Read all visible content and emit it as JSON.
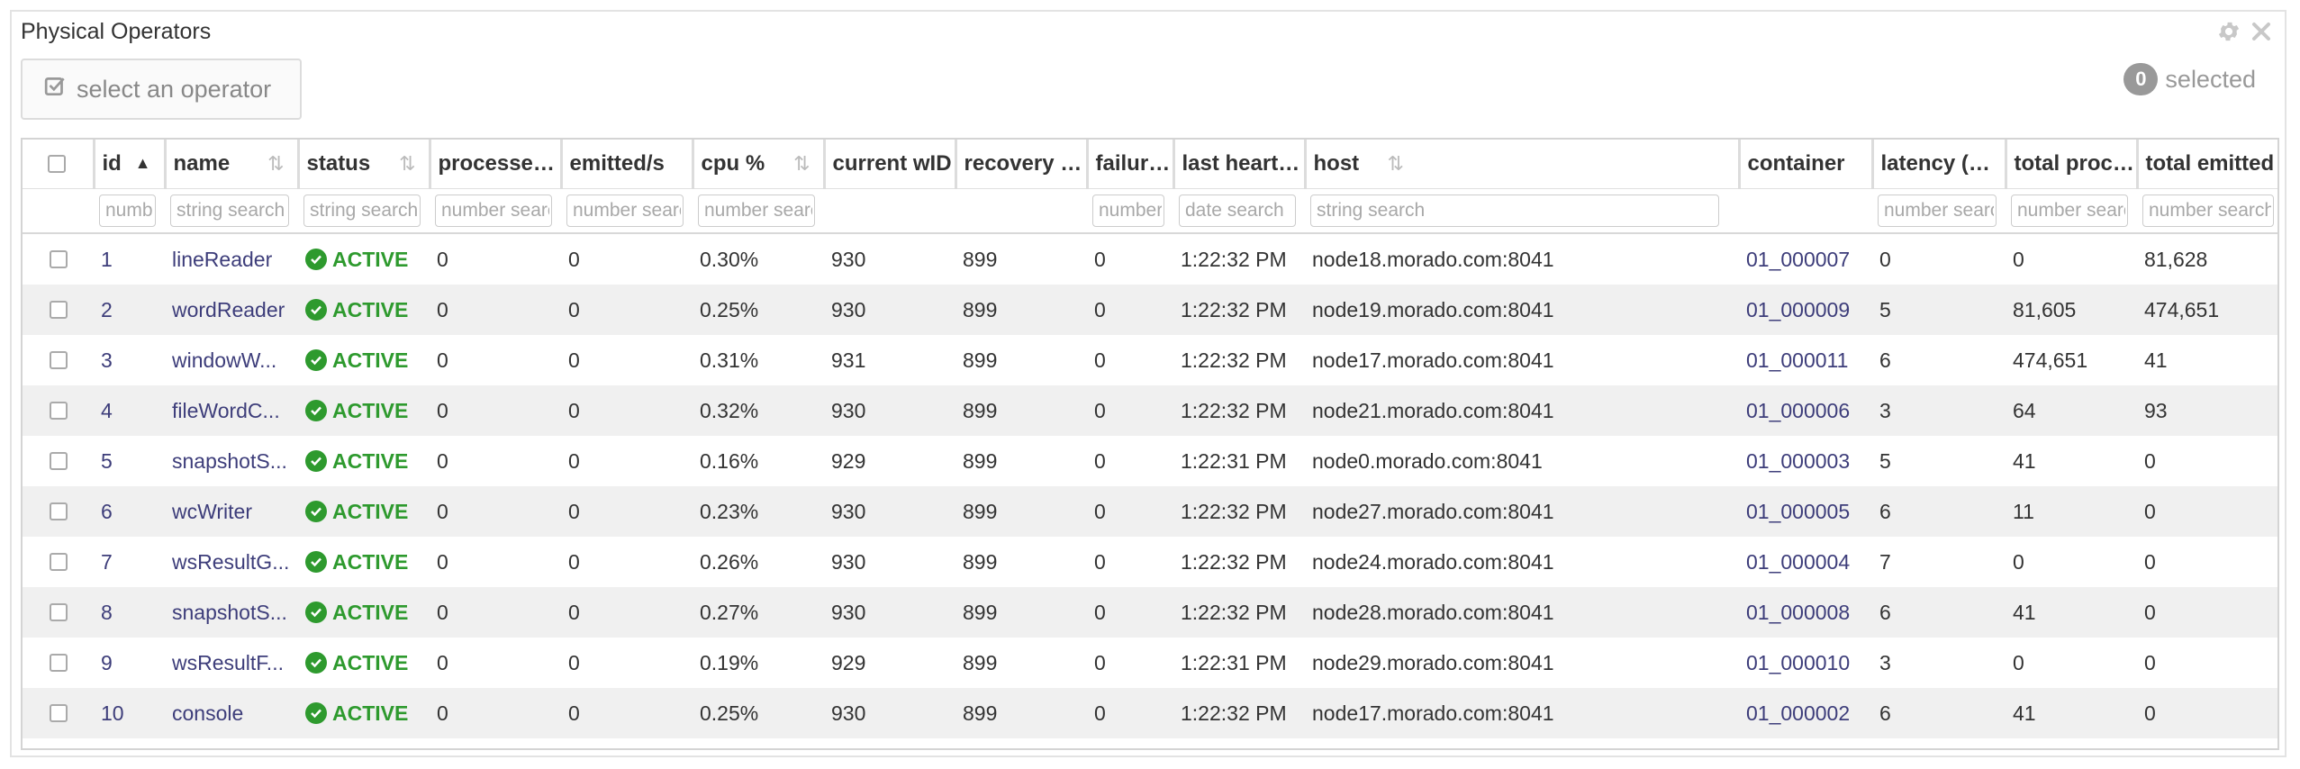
{
  "panel": {
    "title": "Physical Operators",
    "select_label": "select an operator",
    "selected_count": "0",
    "selected_label": "selected"
  },
  "columns": [
    {
      "label": "id",
      "filter": "number"
    },
    {
      "label": "name",
      "filter": "string search"
    },
    {
      "label": "status",
      "filter": "string search"
    },
    {
      "label": "processed/s",
      "filter": "number search"
    },
    {
      "label": "emitted/s",
      "filter": "number search"
    },
    {
      "label": "cpu %",
      "filter": "number search"
    },
    {
      "label": "current wID",
      "filter": ""
    },
    {
      "label": "recovery wID",
      "filter": ""
    },
    {
      "label": "failures",
      "filter": "number"
    },
    {
      "label": "last heartbeat",
      "filter": "date search"
    },
    {
      "label": "host",
      "filter": "string search"
    },
    {
      "label": "container",
      "filter": ""
    },
    {
      "label": "latency (ms)",
      "filter": "number search"
    },
    {
      "label": "total processed",
      "filter": "number search"
    },
    {
      "label": "total emitted",
      "filter": "number search"
    }
  ],
  "rows": [
    {
      "id": "1",
      "name": "lineReader",
      "status": "ACTIVE",
      "processed": "0",
      "emitted": "0",
      "cpu": "0.30%",
      "current": "930",
      "recovery": "899",
      "failures": "0",
      "heartbeat": "1:22:32 PM",
      "host": "node18.morado.com:8041",
      "container": "01_000007",
      "latency": "0",
      "total_processed": "0",
      "total_emitted": "81,628"
    },
    {
      "id": "2",
      "name": "wordReader",
      "status": "ACTIVE",
      "processed": "0",
      "emitted": "0",
      "cpu": "0.25%",
      "current": "930",
      "recovery": "899",
      "failures": "0",
      "heartbeat": "1:22:32 PM",
      "host": "node19.morado.com:8041",
      "container": "01_000009",
      "latency": "5",
      "total_processed": "81,605",
      "total_emitted": "474,651"
    },
    {
      "id": "3",
      "name": "windowW...",
      "status": "ACTIVE",
      "processed": "0",
      "emitted": "0",
      "cpu": "0.31%",
      "current": "931",
      "recovery": "899",
      "failures": "0",
      "heartbeat": "1:22:32 PM",
      "host": "node17.morado.com:8041",
      "container": "01_000011",
      "latency": "6",
      "total_processed": "474,651",
      "total_emitted": "41"
    },
    {
      "id": "4",
      "name": "fileWordC...",
      "status": "ACTIVE",
      "processed": "0",
      "emitted": "0",
      "cpu": "0.32%",
      "current": "930",
      "recovery": "899",
      "failures": "0",
      "heartbeat": "1:22:32 PM",
      "host": "node21.morado.com:8041",
      "container": "01_000006",
      "latency": "3",
      "total_processed": "64",
      "total_emitted": "93"
    },
    {
      "id": "5",
      "name": "snapshotS...",
      "status": "ACTIVE",
      "processed": "0",
      "emitted": "0",
      "cpu": "0.16%",
      "current": "929",
      "recovery": "899",
      "failures": "0",
      "heartbeat": "1:22:31 PM",
      "host": "node0.morado.com:8041",
      "container": "01_000003",
      "latency": "5",
      "total_processed": "41",
      "total_emitted": "0"
    },
    {
      "id": "6",
      "name": "wcWriter",
      "status": "ACTIVE",
      "processed": "0",
      "emitted": "0",
      "cpu": "0.23%",
      "current": "930",
      "recovery": "899",
      "failures": "0",
      "heartbeat": "1:22:32 PM",
      "host": "node27.morado.com:8041",
      "container": "01_000005",
      "latency": "6",
      "total_processed": "11",
      "total_emitted": "0"
    },
    {
      "id": "7",
      "name": "wsResultG...",
      "status": "ACTIVE",
      "processed": "0",
      "emitted": "0",
      "cpu": "0.26%",
      "current": "930",
      "recovery": "899",
      "failures": "0",
      "heartbeat": "1:22:32 PM",
      "host": "node24.morado.com:8041",
      "container": "01_000004",
      "latency": "7",
      "total_processed": "0",
      "total_emitted": "0"
    },
    {
      "id": "8",
      "name": "snapshotS...",
      "status": "ACTIVE",
      "processed": "0",
      "emitted": "0",
      "cpu": "0.27%",
      "current": "930",
      "recovery": "899",
      "failures": "0",
      "heartbeat": "1:22:32 PM",
      "host": "node28.morado.com:8041",
      "container": "01_000008",
      "latency": "6",
      "total_processed": "41",
      "total_emitted": "0"
    },
    {
      "id": "9",
      "name": "wsResultF...",
      "status": "ACTIVE",
      "processed": "0",
      "emitted": "0",
      "cpu": "0.19%",
      "current": "929",
      "recovery": "899",
      "failures": "0",
      "heartbeat": "1:22:31 PM",
      "host": "node29.morado.com:8041",
      "container": "01_000010",
      "latency": "3",
      "total_processed": "0",
      "total_emitted": "0"
    },
    {
      "id": "10",
      "name": "console",
      "status": "ACTIVE",
      "processed": "0",
      "emitted": "0",
      "cpu": "0.25%",
      "current": "930",
      "recovery": "899",
      "failures": "0",
      "heartbeat": "1:22:32 PM",
      "host": "node17.morado.com:8041",
      "container": "01_000002",
      "latency": "6",
      "total_processed": "41",
      "total_emitted": "0"
    }
  ],
  "colors": {
    "active": "#2e9a2e",
    "link": "#3d3d7a",
    "badge": "#999999"
  },
  "icons": {
    "settings": "gear-icon",
    "close": "close-icon",
    "select": "checkbox-edit-icon",
    "status": "check-circle-icon"
  }
}
